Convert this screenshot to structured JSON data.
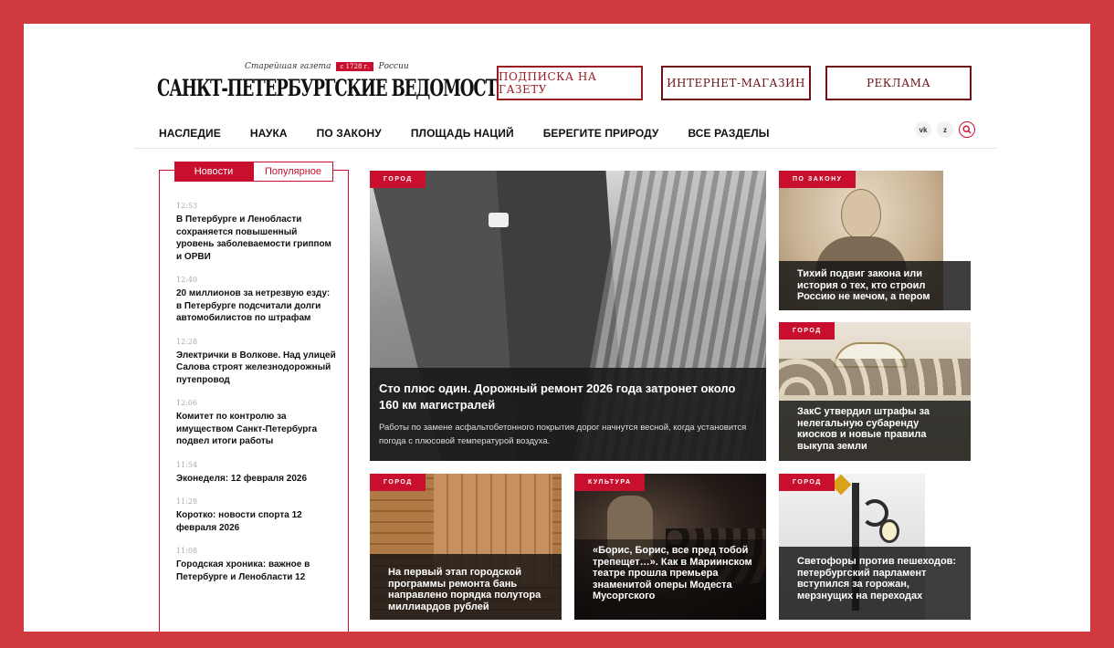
{
  "header": {
    "logo": {
      "tagline_left": "Старейшая газета",
      "tagline_ribbon": "с 1728 г.",
      "tagline_right": "России",
      "wordmark": "САНКТ-ПЕТЕРБУРГСКИЕ ВЕДОМОСТИ"
    },
    "buttons": {
      "subscribe": "ПОДПИСКА НА ГАЗЕТУ",
      "shop": "ИНТЕРНЕТ-МАГАЗИН",
      "ads": "РЕКЛАМА"
    },
    "nav": [
      "НАСЛЕДИЕ",
      "НАУКА",
      "ПО ЗАКОНУ",
      "ПЛОЩАДЬ НАЦИЙ",
      "БЕРЕГИТЕ ПРИРОДУ",
      "ВСЕ РАЗДЕЛЫ"
    ],
    "social": {
      "vk": "vk",
      "zen": "z"
    }
  },
  "sidebar": {
    "tabs": {
      "active": "Новости",
      "inactive": "Популярное"
    },
    "items": [
      {
        "time": "12:53",
        "title": "В Петербурге и Ленобласти сохраняется повышенный уровень заболеваемости гриппом и ОРВИ"
      },
      {
        "time": "12:40",
        "title": "20 миллионов за нетрезвую езду: в Петербурге подсчитали долги автомобилистов по штрафам"
      },
      {
        "time": "12:28",
        "title": "Электрички в Волкове. Над улицей Салова строят железнодорожный путепровод"
      },
      {
        "time": "12:06",
        "title": "Комитет по контролю за имуществом Санкт-Петербурга подвел итоги работы"
      },
      {
        "time": "11:54",
        "title": "Эконеделя: 12 февраля 2026"
      },
      {
        "time": "11:28",
        "title": "Коротко: новости спорта 12 февраля 2026"
      },
      {
        "time": "11:08",
        "title": "Городская хроника: важное в Петербурге и Ленобласти 12"
      }
    ]
  },
  "main": {
    "badge": "ГОРОД",
    "title": "Сто плюс один. Дорожный ремонт 2026 года затронет около 160 км магистралей",
    "lead": "Работы по замене асфальтобетонного покрытия дорог начнутся весной, когда установится погода с плюсовой температурой воздуха."
  },
  "cards": {
    "law": {
      "badge": "ПО ЗАКОНУ",
      "title": "Тихий подвиг закона или история о тех, кто строил Россию не мечом, а пером"
    },
    "zaks": {
      "badge": "ГОРОД",
      "title": "ЗакС утвердил штрафы за нелегальную субаренду киосков и новые правила выкупа земли"
    },
    "sauna": {
      "badge": "ГОРОД",
      "title": "На первый этап городской программы ремонта бань направлено порядка полутора миллиардов рублей"
    },
    "opera": {
      "badge": "КУЛЬТУРА",
      "title": "«Борис, Борис, все пред тобой трепещет…». Как в Мариинском театре прошла премьера знаменитой оперы Модеста Мусоргского"
    },
    "lights": {
      "badge": "ГОРОД",
      "title": "Светофоры против пешеходов: петербургский парламент вступился за горожан, мерзнущих на переходах"
    }
  },
  "colors": {
    "frame": "#d0393e",
    "accent": "#c8102e",
    "button_border": "#9a1c22"
  }
}
